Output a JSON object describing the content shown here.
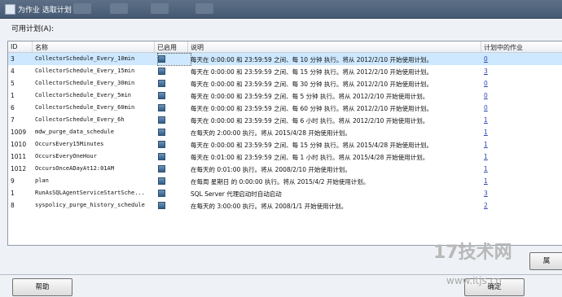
{
  "window": {
    "title": "为作业 选取计划"
  },
  "available_label": "可用计划(A):",
  "table": {
    "columns": [
      "ID",
      "名称",
      "已启用",
      "说明",
      "计划中的作业"
    ],
    "rows": [
      {
        "id": "3",
        "name": "CollectorSchedule_Every_10min",
        "desc": "每天在 0:00:00 和 23:59:59 之间、每 10 分钟 执行。将从 2012/2/10 开始使用计划。",
        "jobs": "0",
        "selected": true
      },
      {
        "id": "4",
        "name": "CollectorSchedule_Every_15min",
        "desc": "每天在 0:00:00 和 23:59:59 之间、每 15 分钟 执行。将从 2012/2/10 开始使用计划。",
        "jobs": "3"
      },
      {
        "id": "5",
        "name": "CollectorSchedule_Every_30min",
        "desc": "每天在 0:00:00 和 23:59:59 之间、每 30 分钟 执行。将从 2012/2/10 开始使用计划。",
        "jobs": "0"
      },
      {
        "id": "1",
        "name": "CollectorSchedule_Every_5min",
        "desc": "每天在 0:00:00 和 23:59:59 之间、每 5 分钟 执行。将从 2012/2/10 开始使用计划。",
        "jobs": "0"
      },
      {
        "id": "6",
        "name": "CollectorSchedule_Every_60min",
        "desc": "每天在 0:00:00 和 23:59:59 之间、每 60 分钟 执行。将从 2012/2/10 开始使用计划。",
        "jobs": "0"
      },
      {
        "id": "7",
        "name": "CollectorSchedule_Every_6h",
        "desc": "每天在 0:00:00 和 23:59:59 之间、每 6 小时 执行。将从 2012/2/10 开始使用计划。",
        "jobs": "1"
      },
      {
        "id": "1009",
        "name": "mdw_purge_data_schedule",
        "desc": "在每天的 2:00:00 执行。将从 2015/4/28 开始使用计划。",
        "jobs": "1"
      },
      {
        "id": "1010",
        "name": "OccursEvery15Minutes",
        "desc": "每天在 0:00:00 和 23:59:59 之间、每 15 分钟 执行。将从 2015/4/28 开始使用计划。",
        "jobs": "1"
      },
      {
        "id": "1011",
        "name": "OccursEveryOneHour",
        "desc": "每天在 0:01:00 和 23:59:59 之间、每 1 小时 执行。将从 2015/4/28 开始使用计划。",
        "jobs": "1"
      },
      {
        "id": "1012",
        "name": "OccursOnceADayAt12:01AM",
        "desc": "在每天的 0:01:00 执行。将从 2008/2/10 开始使用计划。",
        "jobs": "1"
      },
      {
        "id": "9",
        "name": "plan",
        "desc": "在每周 星期日 的 0:00:00 执行。将从 2015/4/2 开始使用计划。",
        "jobs": "1"
      },
      {
        "id": "1",
        "name": "RunAsSQLAgentServiceStartSche...",
        "desc": "SQL Server 代理启动时自动启动",
        "jobs": "3"
      },
      {
        "id": "8",
        "name": "syspolicy_purge_history_schedule",
        "desc": "在每天的 3:00:00 执行。将从 2008/1/1 开始使用计划。",
        "jobs": "2"
      }
    ]
  },
  "buttons": {
    "help": "帮助",
    "ok": "确定",
    "properties": "属"
  },
  "watermark": {
    "logo": "17技术网",
    "url": "www.itjs.cn"
  }
}
